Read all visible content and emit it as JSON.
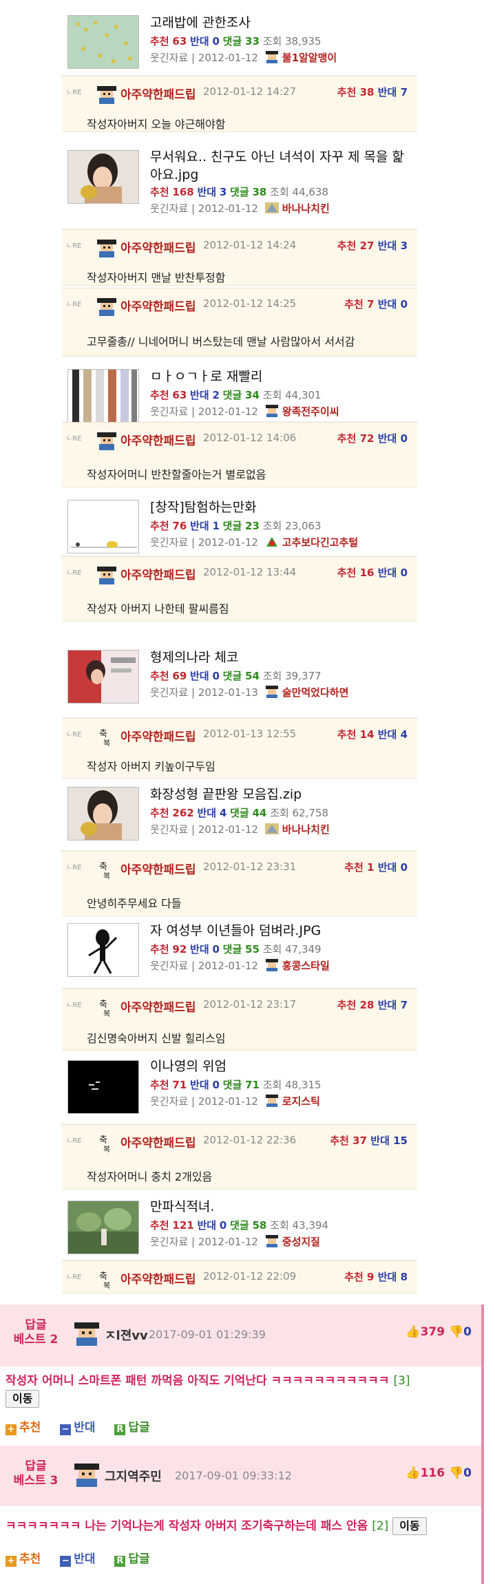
{
  "posts": [
    {
      "title": "고래밥에 관한조사",
      "rec_label": "추천",
      "rec": "63",
      "opp_label": "반대",
      "opp": "0",
      "cmt_label": "댓글",
      "cmt": "33",
      "views_label": "조회",
      "views": "38,935",
      "category": "웃긴자료",
      "date": "2012-01-12",
      "author": "불1알알맹이"
    },
    {
      "title": "무서워요.. 친구도 아닌 녀석이 자꾸 제 목을 핥아요.jpg",
      "rec_label": "추천",
      "rec": "168",
      "opp_label": "반대",
      "opp": "3",
      "cmt_label": "댓글",
      "cmt": "38",
      "views_label": "조회",
      "views": "44,638",
      "category": "웃긴자료",
      "date": "2012-01-12",
      "author": "바나나치킨"
    },
    {
      "title": "ㅁㅏㅇㄱㅏ로 재빨리",
      "rec_label": "추천",
      "rec": "63",
      "opp_label": "반대",
      "opp": "2",
      "cmt_label": "댓글",
      "cmt": "34",
      "views_label": "조회",
      "views": "44,301",
      "category": "웃긴자료",
      "date": "2012-01-12",
      "author": "왕족전주이씨"
    },
    {
      "title": "[창작]탐험하는만화",
      "rec_label": "추천",
      "rec": "76",
      "opp_label": "반대",
      "opp": "1",
      "cmt_label": "댓글",
      "cmt": "23",
      "views_label": "조회",
      "views": "23,063",
      "category": "웃긴자료",
      "date": "2012-01-12",
      "author": "고추보다긴고추털"
    },
    {
      "title": "형제의나라 체코",
      "rec_label": "추천",
      "rec": "69",
      "opp_label": "반대",
      "opp": "0",
      "cmt_label": "댓글",
      "cmt": "54",
      "views_label": "조회",
      "views": "39,377",
      "category": "웃긴자료",
      "date": "2012-01-13",
      "author": "술만먹었다하면"
    },
    {
      "title": "화장성형 끝판왕 모음집.zip",
      "rec_label": "추천",
      "rec": "262",
      "opp_label": "반대",
      "opp": "4",
      "cmt_label": "댓글",
      "cmt": "44",
      "views_label": "조회",
      "views": "62,758",
      "category": "웃긴자료",
      "date": "2012-01-12",
      "author": "바나나치킨"
    },
    {
      "title": "자 여성부 이년들아 덤벼라.JPG",
      "rec_label": "추천",
      "rec": "92",
      "opp_label": "반대",
      "opp": "0",
      "cmt_label": "댓글",
      "cmt": "55",
      "views_label": "조회",
      "views": "47,349",
      "category": "웃긴자료",
      "date": "2012-01-12",
      "author": "홍콩스타일"
    },
    {
      "title": "이나영의 위엄",
      "rec_label": "추천",
      "rec": "71",
      "opp_label": "반대",
      "opp": "0",
      "cmt_label": "댓글",
      "cmt": "71",
      "views_label": "조회",
      "views": "48,315",
      "category": "웃긴자료",
      "date": "2012-01-12",
      "author": "로지스틱"
    },
    {
      "title": "만파식적녀.",
      "rec_label": "추천",
      "rec": "121",
      "opp_label": "반대",
      "opp": "0",
      "cmt_label": "댓글",
      "cmt": "58",
      "views_label": "조회",
      "views": "43,394",
      "category": "웃긴자료",
      "date": "2012-01-12",
      "author": "중성지질"
    }
  ],
  "replies": [
    {
      "tag": "ㄴRE",
      "name": "아주약한패드립",
      "time": "2012-01-12 14:27",
      "rec_label": "추천",
      "rec": "38",
      "opp_label": "반대",
      "opp": "7",
      "text": "작성자아버지 오늘 야근해야함"
    },
    {
      "tag": "ㄴRE",
      "name": "아주약한패드립",
      "time": "2012-01-12 14:24",
      "rec_label": "추천",
      "rec": "27",
      "opp_label": "반대",
      "opp": "3",
      "text": "작성자아버지 맨날 반찬투정함"
    },
    {
      "tag": "ㄴRE",
      "name": "아주약한패드립",
      "time": "2012-01-12 14:25",
      "rec_label": "추천",
      "rec": "7",
      "opp_label": "반대",
      "opp": "0",
      "text": "고무줄총// 니네어머니 버스탔는데 맨날 사람많아서 서서감"
    },
    {
      "tag": "ㄴRE",
      "name": "아주약한패드립",
      "time": "2012-01-12 14:06",
      "rec_label": "추천",
      "rec": "72",
      "opp_label": "반대",
      "opp": "0",
      "text": "작성자어머니 반찬할줄아는거 별로없음"
    },
    {
      "tag": "ㄴRE",
      "name": "아주약한패드립",
      "time": "2012-01-12 13:44",
      "rec_label": "추천",
      "rec": "16",
      "opp_label": "반대",
      "opp": "0",
      "text": "작성자 아버지 나한테 팔씨름짐"
    },
    {
      "tag": "ㄴRE",
      "name": "아주약한패드립",
      "time": "2012-01-13 12:55",
      "rec_label": "추천",
      "rec": "14",
      "opp_label": "반대",
      "opp": "4",
      "text": "작성자 아버지 키높이구두임"
    },
    {
      "tag": "ㄴRE",
      "name": "아주약한패드립",
      "time": "2012-01-12 23:31",
      "rec_label": "추천",
      "rec": "1",
      "opp_label": "반대",
      "opp": "0",
      "text": "안녕히주무세요 다들"
    },
    {
      "tag": "ㄴRE",
      "name": "아주약한패드립",
      "time": "2012-01-12 23:17",
      "rec_label": "추천",
      "rec": "28",
      "opp_label": "반대",
      "opp": "7",
      "text": "김신명숙아버지 신발 힐리스임"
    },
    {
      "tag": "ㄴRE",
      "name": "아주약한패드립",
      "time": "2012-01-12 22:36",
      "rec_label": "추천",
      "rec": "37",
      "opp_label": "반대",
      "opp": "15",
      "text": "작성자어머니 충치 2개있음"
    },
    {
      "tag": "ㄴRE",
      "name": "아주약한패드립",
      "time": "2012-01-12 22:09",
      "rec_label": "추천",
      "rec": "9",
      "opp_label": "반대",
      "opp": "8",
      "text": ""
    }
  ],
  "best_comments": [
    {
      "label_line1": "답글",
      "label_line2": "베스트 2",
      "name": "ㅈl젼vv",
      "time": "2017-09-01 01:29:39",
      "up": "379",
      "down": "0",
      "text": "작성자 어머니 스마트폰 패턴 까먹음 아직도 기억난다 ㅋㅋㅋㅋㅋㅋㅋㅋㅋㅋㅋ",
      "count": "[3]",
      "move_label": "이동",
      "rec_label": "추천",
      "opp_label": "반대",
      "reply_label": "답글"
    },
    {
      "label_line1": "답글",
      "label_line2": "베스트 3",
      "name": "그지역주민",
      "time": "2017-09-01 09:33:12",
      "up": "116",
      "down": "0",
      "text": "ㅋㅋㅋㅋㅋㅋㅋ 나는 기억나는게 작성자 아버지 조기축구하는데 패스 안옴",
      "count": "[2]",
      "move_label": "이동",
      "rec_label": "추천",
      "opp_label": "반대",
      "reply_label": "답글"
    }
  ],
  "colors": {
    "recommend": "#c0262f",
    "oppose": "#2a3ea6",
    "comment": "#2c8a1b",
    "reply_bg": "#fdf8ea",
    "best_bg": "#fbe3e7",
    "best_accent": "#d0245a"
  }
}
